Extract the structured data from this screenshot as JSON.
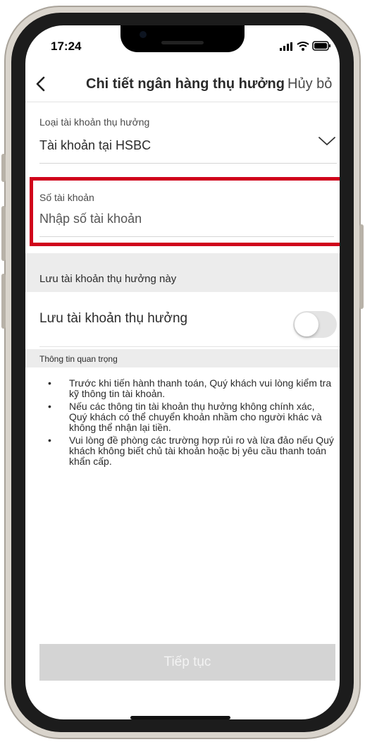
{
  "status_bar": {
    "time": "17:24"
  },
  "header": {
    "title": "Chi tiết ngân hàng thụ hưởng",
    "cancel_label": "Hủy bỏ"
  },
  "account_type": {
    "label": "Loại tài khoản thụ hưởng",
    "value": "Tài khoản tại HSBC"
  },
  "account_number": {
    "label": "Số tài khoản",
    "placeholder": "Nhập số tài khoản"
  },
  "save_section": {
    "title": "Lưu tài khoản thụ hưởng này",
    "toggle_label": "Lưu tài khoản thụ hưởng",
    "toggle_on": false
  },
  "important": {
    "title": "Thông tin quan trọng",
    "items": [
      "Trước khi tiến hành thanh toán, Quý khách vui lòng kiểm tra kỹ thông tin tài khoản.",
      "Nếu các thông tin tài khoản thụ hưởng không chính xác, Quý khách có thể chuyển khoản nhầm cho người khác và không thể nhận lại tiền.",
      "Vui lòng đề phòng các trường hợp rủi ro và lừa đảo nếu Quý khách không biết chủ tài khoản hoặc bị yêu cầu thanh toán khẩn cấp."
    ]
  },
  "footer": {
    "continue_label": "Tiếp tục"
  },
  "colors": {
    "highlight": "#d0021b",
    "disabled_button": "#d4d4d4",
    "section_bg": "#ececec"
  }
}
